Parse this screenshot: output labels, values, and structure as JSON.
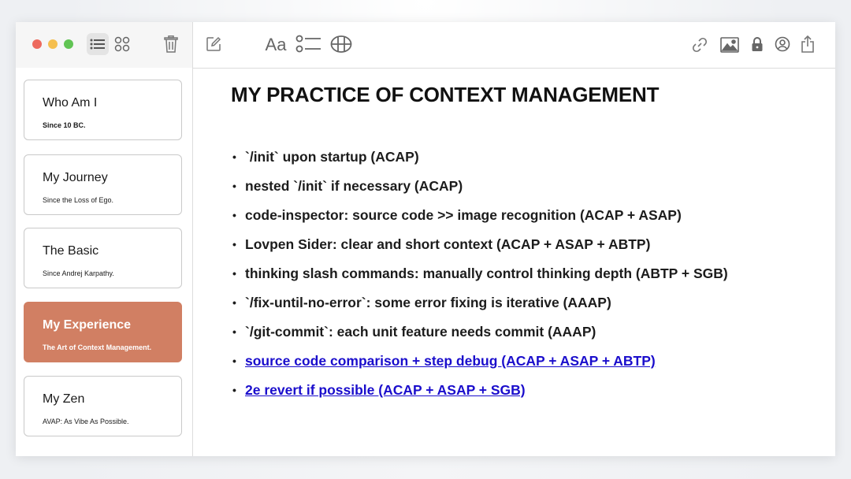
{
  "window": {
    "toolbar": {
      "left_icons": [
        "list-view-icon",
        "gallery-view-icon",
        "trash-icon"
      ],
      "mid_icons": [
        "compose-icon",
        "format-text-icon",
        "checklist-icon",
        "table-icon"
      ],
      "format_label": "Aa",
      "right_icons": [
        "link-icon",
        "image-icon",
        "lock-icon",
        "collaborate-icon",
        "share-icon"
      ]
    }
  },
  "sidebar": {
    "notes": [
      {
        "title": "Who Am I",
        "subtitle": "Since 10 BC."
      },
      {
        "title": "My Journey",
        "subtitle": "Since the Loss of Ego."
      },
      {
        "title": "The Basic",
        "subtitle": "Since Andrej Karpathy."
      },
      {
        "title": "My Experience",
        "subtitle": "The Art of Context Management."
      },
      {
        "title": "My Zen",
        "subtitle": "AVAP: As Vibe As Possible."
      }
    ],
    "active_index": 3
  },
  "document": {
    "title": "MY PRACTICE OF CONTEXT MANAGEMENT",
    "bullet_symbol": "•",
    "items": [
      {
        "text": "`/init` upon startup (ACAP)",
        "link": false
      },
      {
        "text": "nested `/init` if necessary (ACAP)",
        "link": false
      },
      {
        "text": "code-inspector: source code >> image recognition (ACAP + ASAP)",
        "link": false
      },
      {
        "text": "Lovpen Sider: clear and short context (ACAP + ASAP + ABTP)",
        "link": false
      },
      {
        "text": "thinking slash commands: manually control thinking depth (ABTP + SGB)",
        "link": false
      },
      {
        "text": "`/fix-until-no-error`: some error fixing is iterative (AAAP)",
        "link": false
      },
      {
        "text": "`/git-commit`: each unit feature needs commit (AAAP)",
        "link": false
      },
      {
        "text": "source code comparison + step debug (ACAP + ASAP + ABTP)",
        "link": true
      },
      {
        "text": "2e revert if possible (ACAP + ASAP + SGB)",
        "link": true
      }
    ]
  },
  "colors": {
    "accent": "#d17f63",
    "link": "#1a0dcc",
    "traffic_red": "#ed6a5e",
    "traffic_yellow": "#f5bf4f",
    "traffic_green": "#61c454"
  }
}
